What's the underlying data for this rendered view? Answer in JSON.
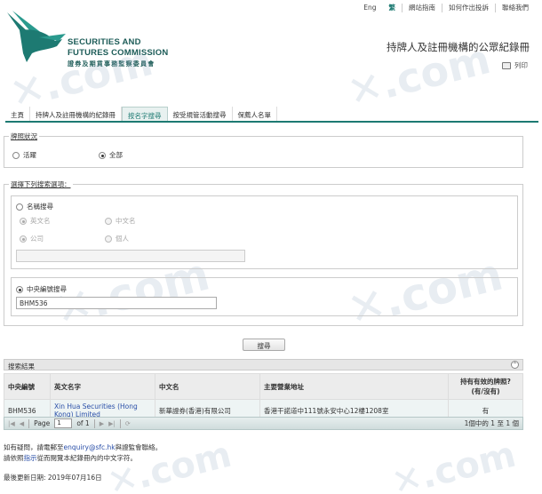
{
  "top_links": [
    "Eng",
    "繁",
    "網站指南",
    "如何作出投訴",
    "聯絡我們"
  ],
  "logo": {
    "en_line1": "SECURITIES AND",
    "en_line2": "FUTURES COMMISSION",
    "zh": "證券及期貨事務監察委員會"
  },
  "page_title": "持牌人及註冊機構的公眾紀錄冊",
  "print_label": "列印",
  "tabs": [
    {
      "label": "主頁"
    },
    {
      "label": "持牌人及註冊機構的紀錄冊"
    },
    {
      "label": "按名字搜尋"
    },
    {
      "label": "按受規管活動搜尋"
    },
    {
      "label": "保薦人名單"
    }
  ],
  "license_status": {
    "legend": "牌照狀況",
    "options": [
      "活躍",
      "全部"
    ],
    "selected": "全部"
  },
  "search_options": {
    "legend": "選擇下列搜索選項：",
    "name_search": {
      "label": "名稱搜尋",
      "name_options": [
        "英文名",
        "中文名"
      ],
      "type_options": [
        "公司",
        "個人"
      ],
      "value": ""
    },
    "ce_search": {
      "label": "中央編號搜尋",
      "value": "BHM536"
    },
    "search_button": "搜尋"
  },
  "results": {
    "title": "搜索結果",
    "columns": [
      "中央編號",
      "英文名字",
      "中文名",
      "主要營業地址",
      "持有有效的牌照?\n(有/沒有)"
    ],
    "rows": [
      {
        "ce": "BHM536",
        "en_name": "Xin Hua Securities (Hong Kong) Limited",
        "zh_name": "新華證券(香港)有限公司",
        "address": "香港干諾道中111號永安中心12樓1208室",
        "licensed": "有"
      }
    ],
    "pager": {
      "page_label": "Page",
      "page_value": "1",
      "of_label": "of 1",
      "info": "1個中的 1 至 1 個"
    }
  },
  "footer": {
    "line1_prefix": "如有疑問，請電郵至",
    "email": "enquiry@sfc.hk",
    "line1_suffix": "與證監會聯絡。",
    "line2_prefix": "請依照",
    "line2_link": "指示",
    "line2_suffix": "從而閱覽本紀錄冊內的中文字符。",
    "last_updated": "最後更新日期: 2019年07月16日"
  },
  "watermark": ".com"
}
